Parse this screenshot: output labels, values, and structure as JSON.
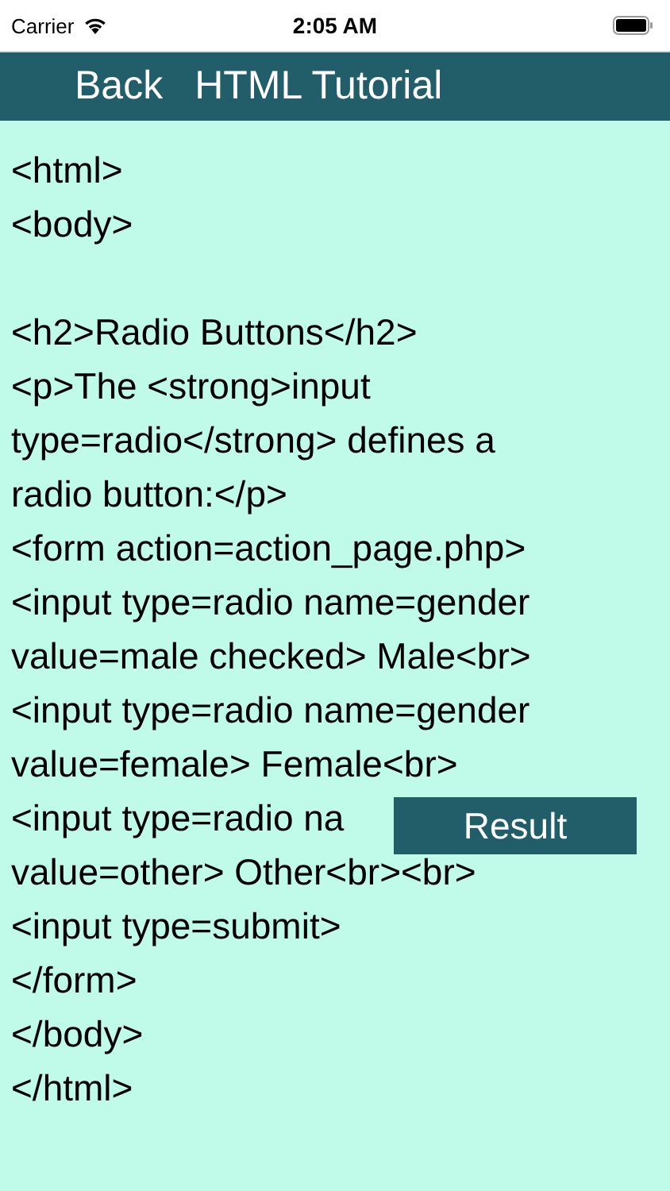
{
  "status_bar": {
    "carrier": "Carrier",
    "time": "2:05 AM"
  },
  "nav_bar": {
    "back": "Back",
    "title": "HTML Tutorial"
  },
  "code_blocks": [
    [
      "<html>",
      "<body>"
    ],
    [
      "<h2>Radio Buttons</h2>",
      "<p>The <strong>input",
      "type=radio</strong> defines a",
      "radio button:</p>",
      "<form action=action_page.php>",
      "<input type=radio name=gender",
      "value=male checked> Male<br>",
      "<input type=radio name=gender",
      "value=female> Female<br>",
      "<input type=radio na",
      "value=other> Other<br><br>",
      "<input type=submit>",
      "</form>",
      "</body>",
      "</html>"
    ]
  ],
  "result_button": "Result"
}
